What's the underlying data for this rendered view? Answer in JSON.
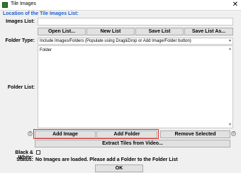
{
  "window": {
    "title": "Tile Images"
  },
  "section_title": "Location of the Tile Images List:",
  "images_list": {
    "label": "Images List:",
    "value": ""
  },
  "toolbar": {
    "open_list": "Open List...",
    "new_list": "New List",
    "save_list": "Save List",
    "save_list_as": "Save List As..."
  },
  "folder_type": {
    "label": "Folder Type:",
    "selected": "Include Images/Folders (Populate using Drag&Drop or Add Image/Folder button)"
  },
  "folder_list": {
    "label": "Folder List:",
    "items": [
      "Folder"
    ]
  },
  "list_buttons": {
    "add_image": "Add Image",
    "add_folder": "Add Folder",
    "remove_selected": "Remove Selected"
  },
  "extract_button": "Extract Tiles from Video...",
  "black_white": {
    "label": "Black & White:",
    "checked": false
  },
  "status": {
    "label": "Status:",
    "text": "No Images are loaded. Please add a Folder to the Folder List"
  },
  "ok_button": "OK",
  "colors": {
    "section_title": "#1f5fcc",
    "highlight_border": "#e03030"
  },
  "icons": {
    "app": "app-icon",
    "close": "close-icon",
    "dropdown": "chevron-down-icon",
    "help": "help-icon"
  }
}
